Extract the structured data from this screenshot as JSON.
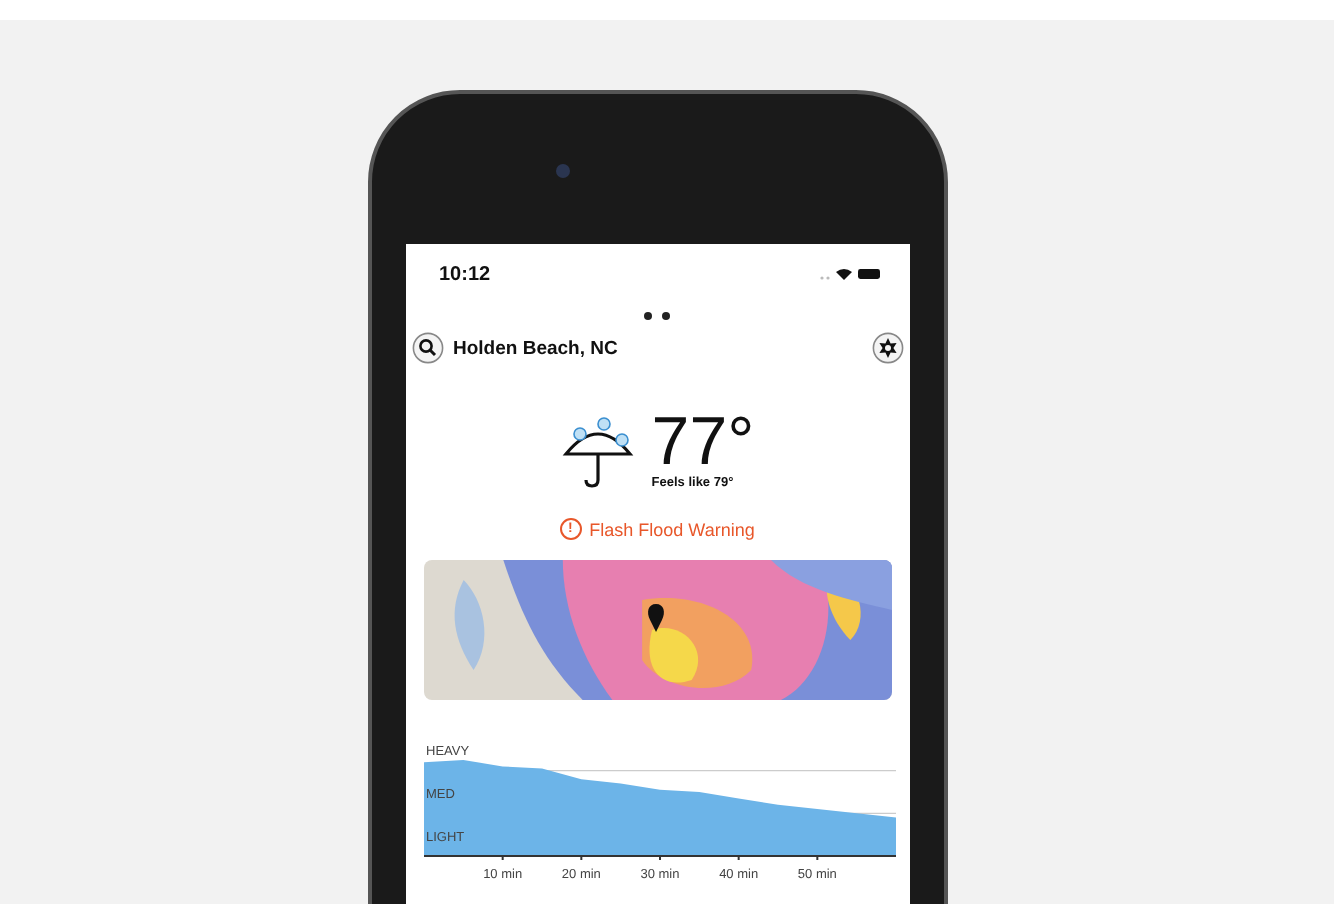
{
  "status_bar": {
    "time": "10:12"
  },
  "page_dots": [
    {
      "selected": true
    },
    {
      "selected": true
    }
  ],
  "header": {
    "location": "Holden Beach, NC"
  },
  "current": {
    "temperature": "77°",
    "feels_like": "Feels like 79°"
  },
  "alert": {
    "icon": "!",
    "text": "Flash Flood Warning"
  },
  "precipitation": {
    "levels": [
      "HEAVY",
      "MED",
      "LIGHT"
    ],
    "time_labels": [
      "10 min",
      "20 min",
      "30 min",
      "40 min",
      "50 min"
    ]
  }
}
